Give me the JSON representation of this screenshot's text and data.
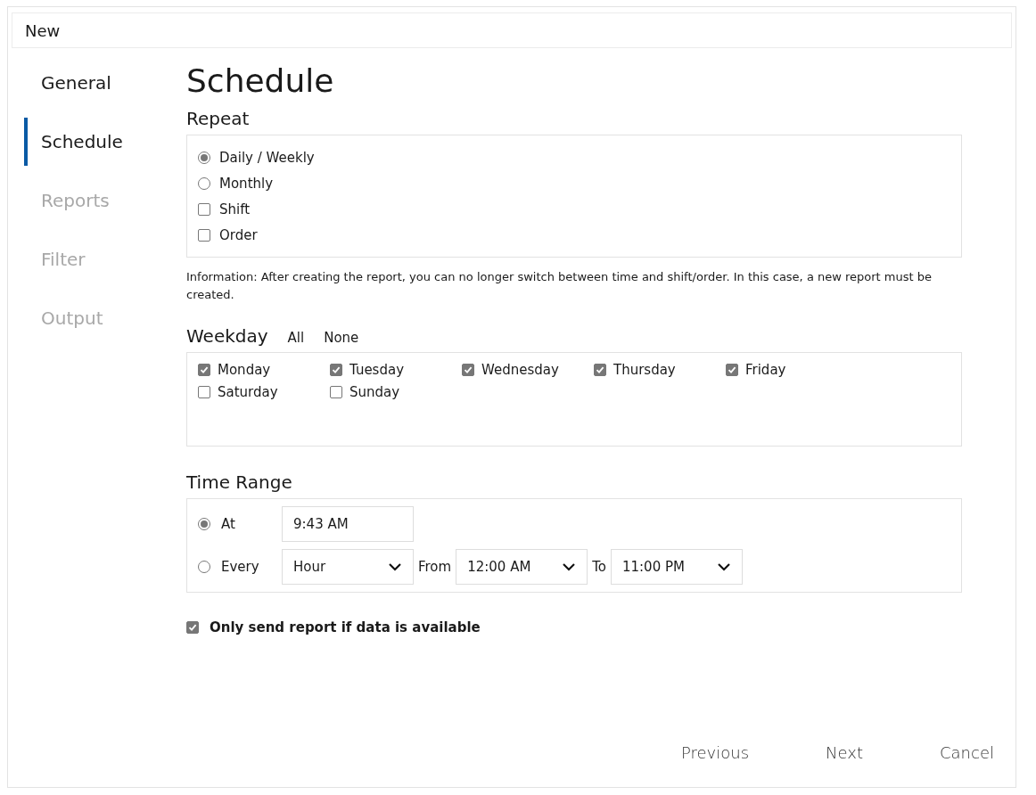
{
  "window": {
    "title": "New"
  },
  "sidebar": {
    "items": [
      {
        "label": "General",
        "selected": false,
        "disabled": false
      },
      {
        "label": "Schedule",
        "selected": true,
        "disabled": false
      },
      {
        "label": "Reports",
        "selected": false,
        "disabled": true
      },
      {
        "label": "Filter",
        "selected": false,
        "disabled": true
      },
      {
        "label": "Output",
        "selected": false,
        "disabled": true
      }
    ]
  },
  "page_title": "Schedule",
  "repeat": {
    "heading": "Repeat",
    "options": [
      {
        "label": "Daily / Weekly",
        "kind": "radio",
        "checked": true
      },
      {
        "label": "Monthly",
        "kind": "radio",
        "checked": false
      },
      {
        "label": "Shift",
        "kind": "checkbox",
        "checked": false
      },
      {
        "label": "Order",
        "kind": "checkbox",
        "checked": false
      }
    ]
  },
  "information": "Information: After creating the report, you can no longer switch between time and shift/order. In this case, a new report must be created.",
  "weekday": {
    "heading": "Weekday",
    "links": [
      "All",
      "None"
    ],
    "days": [
      {
        "label": "Monday",
        "checked": true
      },
      {
        "label": "Tuesday",
        "checked": true
      },
      {
        "label": "Wednesday",
        "checked": true
      },
      {
        "label": "Thursday",
        "checked": true
      },
      {
        "label": "Friday",
        "checked": true
      },
      {
        "label": "Saturday",
        "checked": false
      },
      {
        "label": "Sunday",
        "checked": false
      }
    ]
  },
  "time_range": {
    "heading": "Time Range",
    "options": [
      {
        "label": "At",
        "kind": "time",
        "selected": true,
        "value": "9:43 AM"
      },
      {
        "label": "Every",
        "kind": "interval",
        "selected": false,
        "unit": "Hour",
        "from_label": "From",
        "from": "12:00 AM",
        "to_label": "To",
        "to": "11:00 PM"
      }
    ]
  },
  "only_send": {
    "label": "Only send report if data is available",
    "checked": true
  },
  "buttons": [
    "Previous",
    "Next",
    "Cancel"
  ]
}
